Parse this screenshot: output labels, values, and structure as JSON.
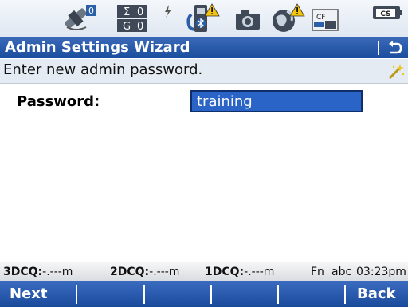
{
  "status_icons": [
    "satellite-icon",
    "position-counter-icon",
    "battery-low-icon",
    "instrument-bluetooth-warning-icon",
    "camera-icon",
    "globe-warning-icon",
    "cf-card-icon",
    "cs-controller-icon"
  ],
  "position_counter": {
    "sigma": "0",
    "sigma_symbol": "Σ",
    "g_symbol": "G",
    "g": "0"
  },
  "satellite_count": "0",
  "cf_label": "CF",
  "cs_label": "CS",
  "title": "Admin Settings Wizard",
  "message": "Enter new admin password.",
  "password_label": "Password:",
  "password_value": "training",
  "info": {
    "q3d_label": "3DCQ:",
    "q3d_value": "-.---m",
    "q2d_label": "2DCQ:",
    "q2d_value": "-.---m",
    "q1d_label": "1DCQ:",
    "q1d_value": "-.---m",
    "fn": "Fn",
    "mode": "abc",
    "time": "03:23pm"
  },
  "softkeys": {
    "f1": "Next",
    "f6": "Back"
  },
  "colors": {
    "title_bar": "#1f519f",
    "field_highlight": "#2a64c6",
    "message_bg": "#e5ebf3"
  }
}
